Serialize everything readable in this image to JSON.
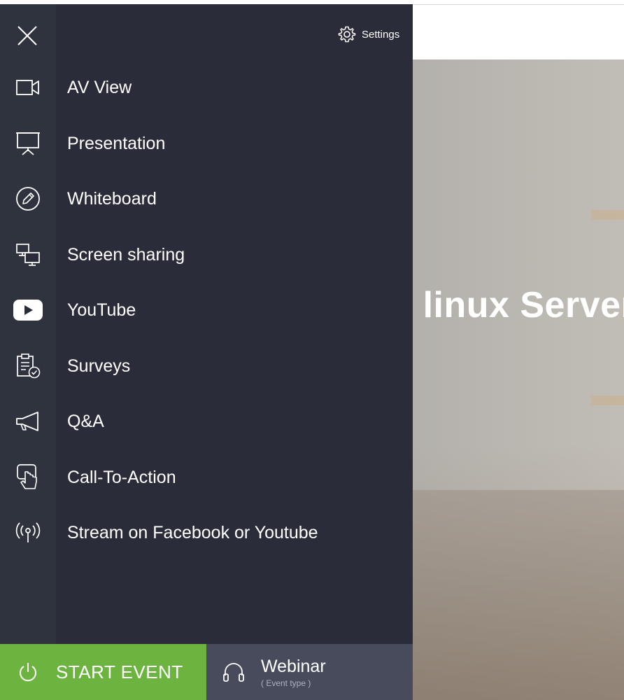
{
  "window": {
    "settings_label": "Settings"
  },
  "background": {
    "event_title": "Learn to setup a linux Server"
  },
  "menu": {
    "items": [
      {
        "label": "AV View",
        "icon": "video-camera-icon"
      },
      {
        "label": "Presentation",
        "icon": "presentation-board-icon"
      },
      {
        "label": "Whiteboard",
        "icon": "pencil-circle-icon"
      },
      {
        "label": "Screen sharing",
        "icon": "screen-sharing-icon"
      },
      {
        "label": "YouTube",
        "icon": "youtube-icon"
      },
      {
        "label": "Surveys",
        "icon": "clipboard-check-icon"
      },
      {
        "label": "Q&A",
        "icon": "megaphone-icon"
      },
      {
        "label": "Call-To-Action",
        "icon": "hand-pointer-icon"
      },
      {
        "label": "Stream on Facebook or Youtube",
        "icon": "broadcast-icon"
      }
    ]
  },
  "bottom_bar": {
    "start_label": "START EVENT",
    "event_type_title": "Webinar",
    "event_type_sub": "( Event type )"
  },
  "colors": {
    "drawer_bg": "#2a2d39",
    "rail_bg": "#2f333e",
    "start_green": "#6cb43f",
    "event_type_bg": "#474b5b"
  }
}
